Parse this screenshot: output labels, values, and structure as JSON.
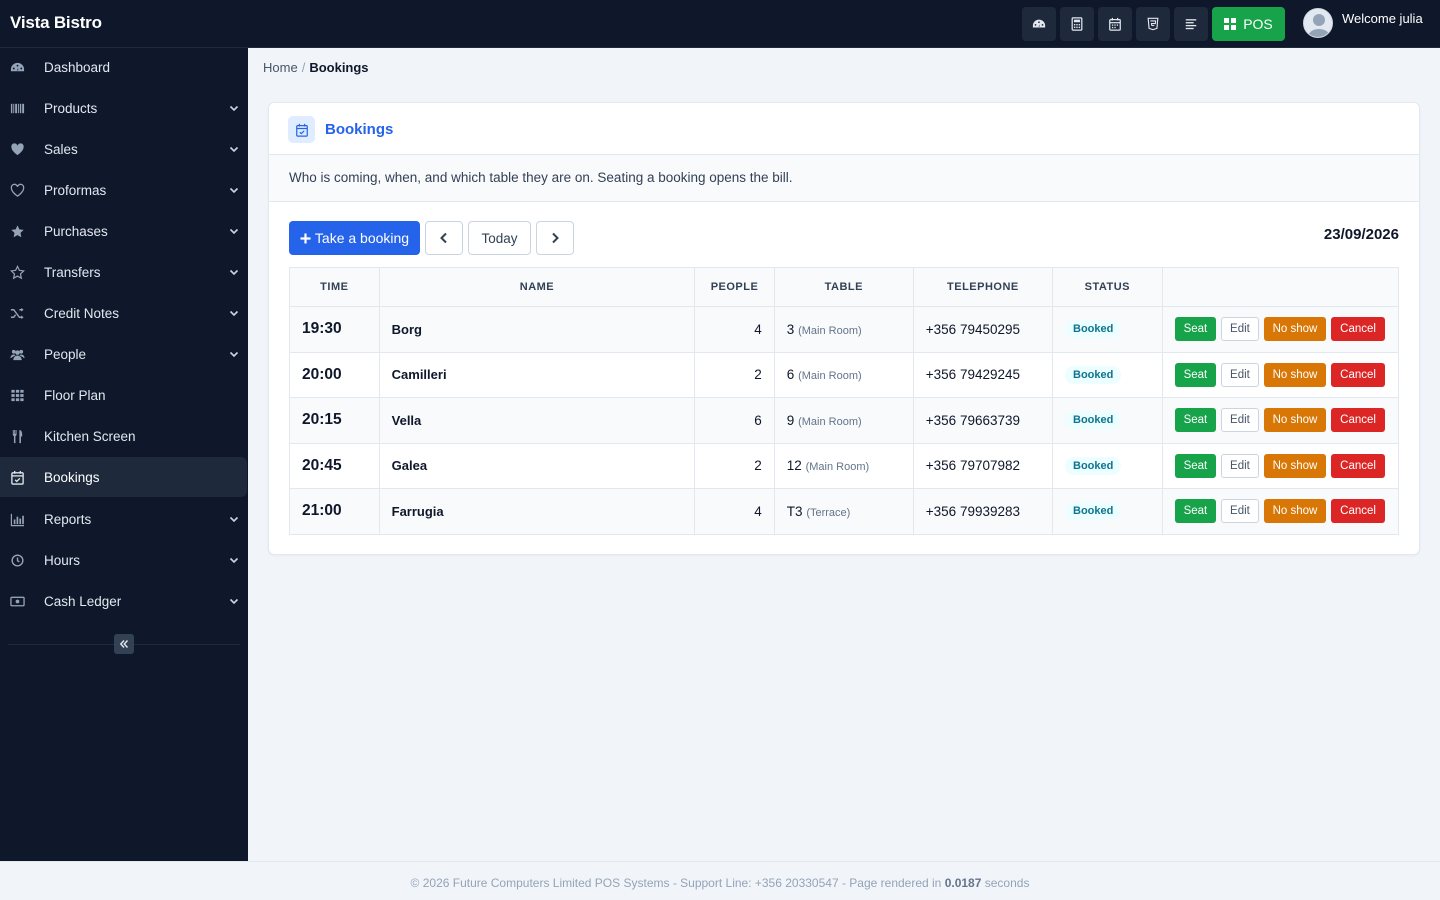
{
  "app": {
    "brand": "Vista Bistro",
    "welcome": "Welcome julia"
  },
  "topbar": {
    "icons": [
      "dashboard-icon",
      "calculator-icon",
      "calendar-icon",
      "css-icon",
      "align-left-icon"
    ],
    "pos_label": "POS",
    "pos_color": "#16a34a"
  },
  "sidebar": {
    "items": [
      {
        "label": "Dashboard",
        "icon": "dashboard-icon",
        "dropdown": false
      },
      {
        "label": "Products",
        "icon": "barcode-icon",
        "dropdown": true
      },
      {
        "label": "Sales",
        "icon": "heart-icon",
        "dropdown": true
      },
      {
        "label": "Proformas",
        "icon": "heart-outline-icon",
        "dropdown": true
      },
      {
        "label": "Purchases",
        "icon": "star-icon",
        "dropdown": true
      },
      {
        "label": "Transfers",
        "icon": "star-outline-icon",
        "dropdown": true
      },
      {
        "label": "Credit Notes",
        "icon": "shuffle-icon",
        "dropdown": true
      },
      {
        "label": "People",
        "icon": "users-icon",
        "dropdown": true
      },
      {
        "label": "Floor Plan",
        "icon": "grid-icon",
        "dropdown": false
      },
      {
        "label": "Kitchen Screen",
        "icon": "utensils-icon",
        "dropdown": false
      },
      {
        "label": "Bookings",
        "icon": "calendar-check-icon",
        "dropdown": false,
        "active": true
      },
      {
        "label": "Reports",
        "icon": "bar-chart-icon",
        "dropdown": true
      },
      {
        "label": "Hours",
        "icon": "clock-icon",
        "dropdown": true
      },
      {
        "label": "Cash Ledger",
        "icon": "money-icon",
        "dropdown": true
      }
    ]
  },
  "breadcrumb": {
    "home": "Home",
    "separator": "/",
    "current": "Bookings"
  },
  "card": {
    "title": "Bookings",
    "description": "Who is coming, when, and which table they are on. Seating a booking opens the bill.",
    "take_booking_label": "Take a booking",
    "today_label": "Today",
    "date": "23/09/2026"
  },
  "table": {
    "headers": [
      "TIME",
      "NAME",
      "PEOPLE",
      "TABLE",
      "TELEPHONE",
      "STATUS",
      ""
    ],
    "rows": [
      {
        "time": "19:30",
        "name": "Borg",
        "people": "4",
        "table": "3",
        "room": "(Main Room)",
        "telephone": "+356 79450295",
        "status": "Booked"
      },
      {
        "time": "20:00",
        "name": "Camilleri",
        "people": "2",
        "table": "6",
        "room": "(Main Room)",
        "telephone": "+356 79429245",
        "status": "Booked"
      },
      {
        "time": "20:15",
        "name": "Vella",
        "people": "6",
        "table": "9",
        "room": "(Main Room)",
        "telephone": "+356 79663739",
        "status": "Booked"
      },
      {
        "time": "20:45",
        "name": "Galea",
        "people": "2",
        "table": "12",
        "room": "(Main Room)",
        "telephone": "+356 79707982",
        "status": "Booked"
      },
      {
        "time": "21:00",
        "name": "Farrugia",
        "people": "4",
        "table": "T3",
        "room": "(Terrace)",
        "telephone": "+356 79939283",
        "status": "Booked"
      }
    ],
    "actions": {
      "seat": "Seat",
      "edit": "Edit",
      "no_show": "No show",
      "cancel": "Cancel"
    }
  },
  "footer": {
    "text": "© 2026 Future Computers Limited POS Systems - Support Line: +356 20330547 - Page rendered in",
    "time": "0.0187",
    "suffix": "seconds"
  }
}
